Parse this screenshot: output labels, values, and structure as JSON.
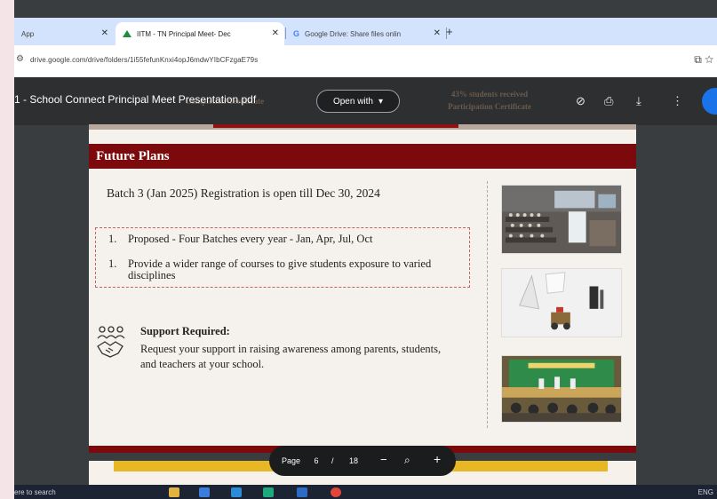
{
  "browser": {
    "tabs": [
      {
        "label": "App"
      },
      {
        "label": "IITM - TN Principal Meet- Dec"
      },
      {
        "label": "Google Drive: Share files onlin"
      }
    ],
    "url": "drive.google.com/drive/folders/1i55fefunKnxi4opJ6mdwYIbCFzgaE79s"
  },
  "viewer": {
    "doc_title": "1 - School Connect Principal Meet Presentation.pdf",
    "open_with_label": "Open with",
    "ghost_left": "Completion Certificate",
    "ghost_right_1": "43% students received",
    "ghost_right_2": "Participation Certificate",
    "page_label": "Page",
    "page_current": "6",
    "page_sep": "/",
    "page_total": "18"
  },
  "slide": {
    "title": "Future Plans",
    "registration": "Batch 3 (Jan 2025) Registration is open till Dec 30, 2024",
    "plans": [
      {
        "num": "1.",
        "text": "Proposed - Four Batches every year - Jan, Apr, Jul, Oct"
      },
      {
        "num": "1.",
        "text": "Provide a wider range of courses to give students exposure to varied disciplines"
      }
    ],
    "support_heading": "Support Required:",
    "support_text": "Request your support in raising awareness among parents, students, and teachers at your school."
  },
  "taskbar": {
    "search_text": "ere to search",
    "tray_text": "ENG"
  },
  "colors": {
    "slide_header": "#7c0a0c",
    "chrome_tabstrip": "#d3e3fd",
    "viewer_bar": "#2d2f31",
    "accent_yellow": "#e8b824"
  }
}
